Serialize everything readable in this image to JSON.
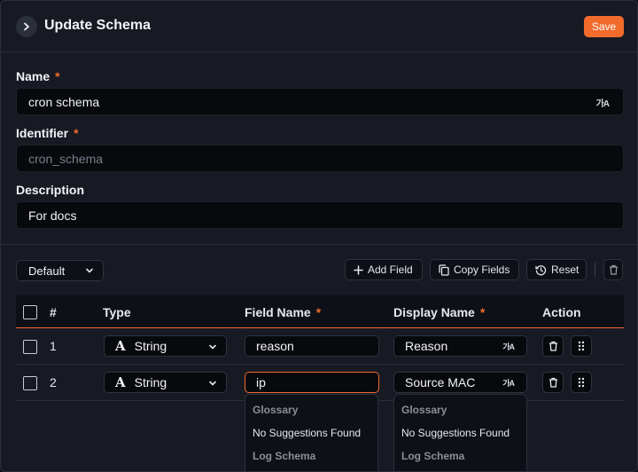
{
  "header": {
    "title": "Update Schema",
    "save_label": "Save"
  },
  "form": {
    "name": {
      "label": "Name",
      "required": "*",
      "value": "cron schema",
      "icon": "translate-icon"
    },
    "identifier": {
      "label": "Identifier",
      "required": "*",
      "value": "cron_schema"
    },
    "description": {
      "label": "Description",
      "value": "For docs"
    }
  },
  "toolbar": {
    "preset": "Default",
    "add_field": "Add Field",
    "copy_fields": "Copy Fields",
    "reset": "Reset"
  },
  "table": {
    "columns": {
      "num": "#",
      "type": "Type",
      "field_name": "Field Name",
      "display_name": "Display Name",
      "action": "Action",
      "required": "*"
    },
    "rows": [
      {
        "num": "1",
        "type": "String",
        "field_name": "reason",
        "display_name": "Reason"
      },
      {
        "num": "2",
        "type": "String",
        "field_name": "ip",
        "display_name": "Source MAC"
      }
    ]
  },
  "suggestions": {
    "field_name": {
      "group1": "Glossary",
      "empty": "No Suggestions Found",
      "group2": "Log Schema"
    },
    "display_name": {
      "group1": "Glossary",
      "empty": "No Suggestions Found",
      "group2": "Log Schema"
    }
  },
  "colors": {
    "accent": "#f26b2b",
    "background": "#171a23",
    "input": "#07090d"
  }
}
